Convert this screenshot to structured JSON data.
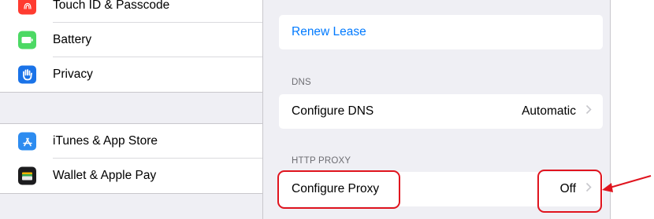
{
  "sidebar": {
    "items_top": [
      {
        "label": "Touch ID & Passcode",
        "icon": "fingerprint-icon",
        "color": "#ff3b30"
      },
      {
        "label": "Battery",
        "icon": "battery-icon",
        "color": "#4cd964"
      },
      {
        "label": "Privacy",
        "icon": "hand-icon",
        "color": "#1a73e8"
      }
    ],
    "items_bottom": [
      {
        "label": "iTunes & App Store",
        "icon": "app-store-icon",
        "color": "#2d8cf0"
      },
      {
        "label": "Wallet & Apple Pay",
        "icon": "wallet-icon",
        "color": "#1c1c1e"
      }
    ]
  },
  "detail": {
    "renew_lease": "Renew Lease",
    "dns_header": "DNS",
    "configure_dns": {
      "label": "Configure DNS",
      "value": "Automatic"
    },
    "http_proxy_header": "HTTP PROXY",
    "configure_proxy": {
      "label": "Configure Proxy",
      "value": "Off"
    }
  },
  "colors": {
    "accent": "#007aff",
    "annotation": "#e0141e",
    "background": "#efeff4"
  }
}
